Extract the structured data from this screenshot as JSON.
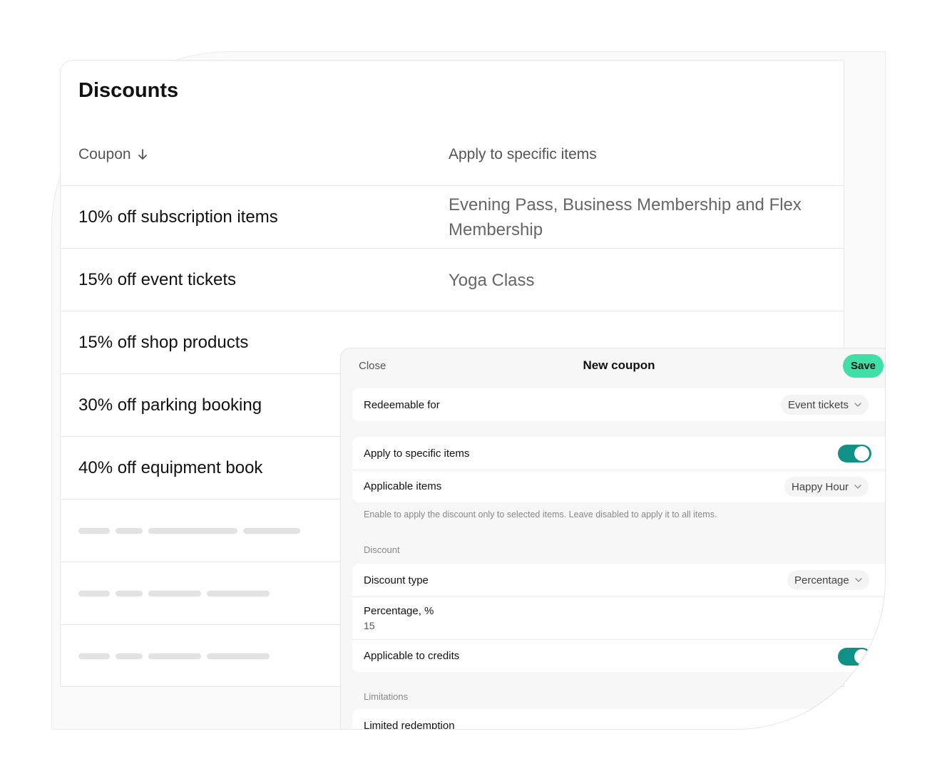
{
  "discounts": {
    "title": "Discounts",
    "columns": {
      "coupon": "Coupon",
      "items": "Apply to specific items"
    },
    "rows": [
      {
        "name": "10% off subscription items",
        "items": "Evening Pass, Business Membership and Flex Membership"
      },
      {
        "name": "15% off event tickets",
        "items": "Yoga Class"
      },
      {
        "name": "15% off shop products",
        "items": ""
      },
      {
        "name": "30% off parking booking",
        "items": ""
      },
      {
        "name": "40% off equipment book",
        "items": ""
      }
    ]
  },
  "panel": {
    "close_label": "Close",
    "title": "New coupon",
    "save_label": "Save",
    "redeemable": {
      "label": "Redeemable for",
      "value": "Event tickets"
    },
    "specific": {
      "label": "Apply to specific items",
      "enabled": true,
      "items_label": "Applicable items",
      "items_value": "Happy Hour",
      "hint": "Enable to apply the discount only to selected items. Leave disabled to apply it to all items."
    },
    "discount": {
      "section": "Discount",
      "type_label": "Discount type",
      "type_value": "Percentage",
      "percentage_label": "Percentage, %",
      "percentage_value": "15",
      "credits_label": "Applicable to credits",
      "credits_enabled": true
    },
    "limitations": {
      "section": "Limitations",
      "limited_label": "Limited redemption"
    }
  },
  "colors": {
    "accent": "#3fe0a7",
    "toggle_on": "#0f9188"
  }
}
